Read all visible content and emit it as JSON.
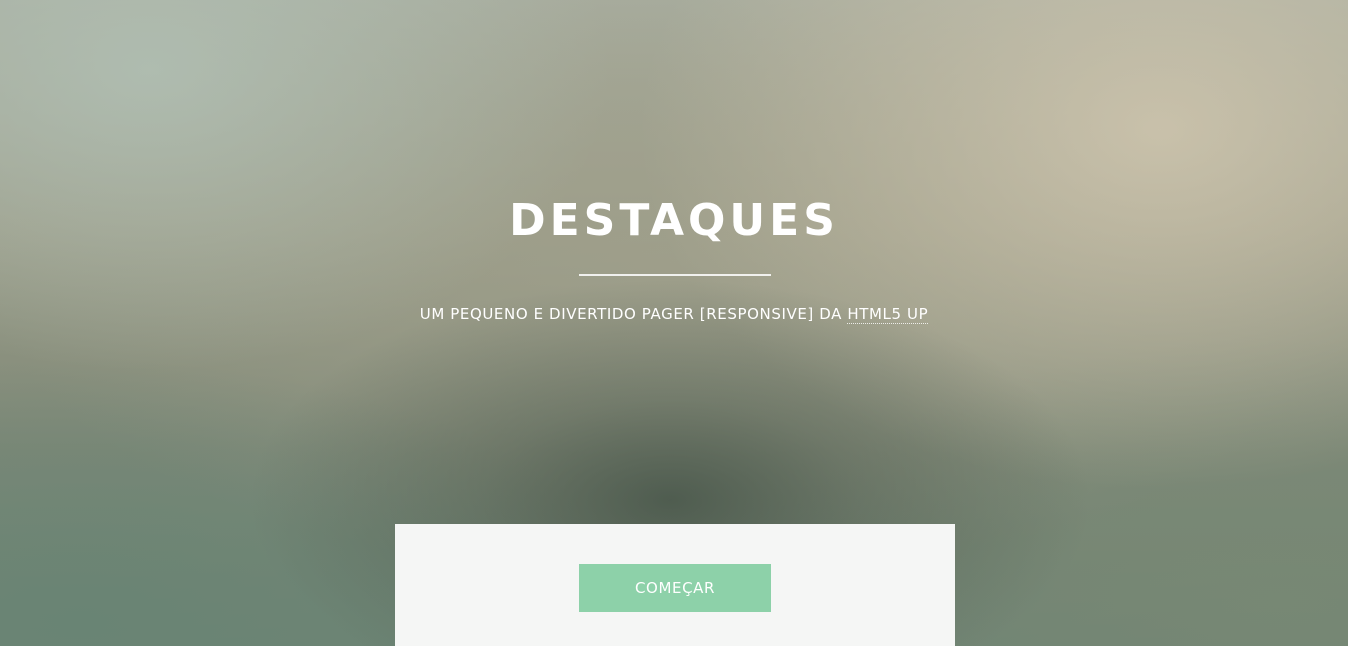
{
  "hero": {
    "title": "DESTAQUES",
    "subtitle_prefix": "UM PEQUENO E DIVERTIDO PAGER [RESPONSIVE] DA ",
    "subtitle_link": "HTML5 UP"
  },
  "panel": {
    "cta_label": "COMEÇAR"
  },
  "colors": {
    "accent": "#8dd1a9",
    "panel_bg": "#f5f6f5",
    "text": "#ffffff"
  }
}
